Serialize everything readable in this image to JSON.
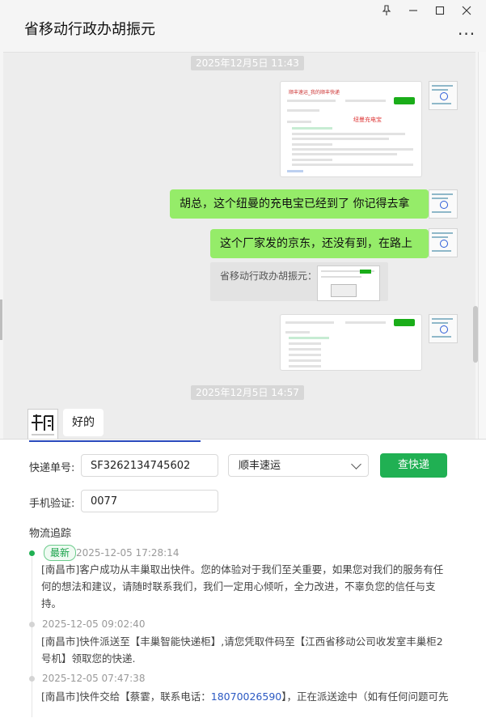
{
  "window": {
    "title": "省移动行政办胡振元",
    "controls": [
      "pin-icon",
      "minimize-icon",
      "maximize-icon",
      "close-icon"
    ],
    "more_icon": "···"
  },
  "chat": {
    "timestamps": [
      "2025年12月5日 11:43",
      "2025年12月5日 14:57"
    ],
    "screenshot_image": {
      "header_text": "顺丰速运_我的顺丰快递",
      "red_note": "纽曼充电宝"
    },
    "messages": [
      {
        "from": "me",
        "type": "image"
      },
      {
        "from": "me",
        "type": "text",
        "text": "胡总，这个纽曼的充电宝已经到了  你记得去拿"
      },
      {
        "from": "me",
        "type": "text",
        "text": "这个厂家发的京东，还没有到，在路上"
      },
      {
        "from": "me",
        "type": "quote",
        "quote_label": "省移动行政办胡振元："
      },
      {
        "from": "me",
        "type": "image"
      },
      {
        "from": "other",
        "type": "text",
        "text": "好的"
      }
    ]
  },
  "tracking": {
    "number_label": "快递单号:",
    "number_value": "SF3262134745602",
    "carrier_selected": "顺丰速运",
    "query_button": "查快递",
    "phone_label": "手机验证:",
    "phone_value": "0077",
    "section_title": "物流追踪",
    "latest_badge": "最新",
    "events": [
      {
        "time": "2025-12-05 17:28:14",
        "text": "[南昌市]客户成功从丰巢取出快件。您的体验对于我们至关重要，如果您对我们的服务有任何的想法和建议，请随时联系我们，我们一定用心倾听，全力改进，不辜负您的信任与支持。"
      },
      {
        "time": "2025-12-05 09:02:40",
        "text": "[南昌市]快件派送至【丰巢智能快递柜】,请您凭取件码至【江西省移动公司收发室丰巢柜2号机】领取您的快递."
      },
      {
        "time": "2025-12-05 07:47:38",
        "text_pre": "[南昌市]快件交给【蔡霎，联系电话：",
        "phone": "18070026590",
        "text_post": "】，正在派送途中（如有任何问题可先"
      }
    ]
  },
  "colors": {
    "green": "#20b053",
    "bubble": "#95ec69",
    "link": "#2b59c3"
  }
}
